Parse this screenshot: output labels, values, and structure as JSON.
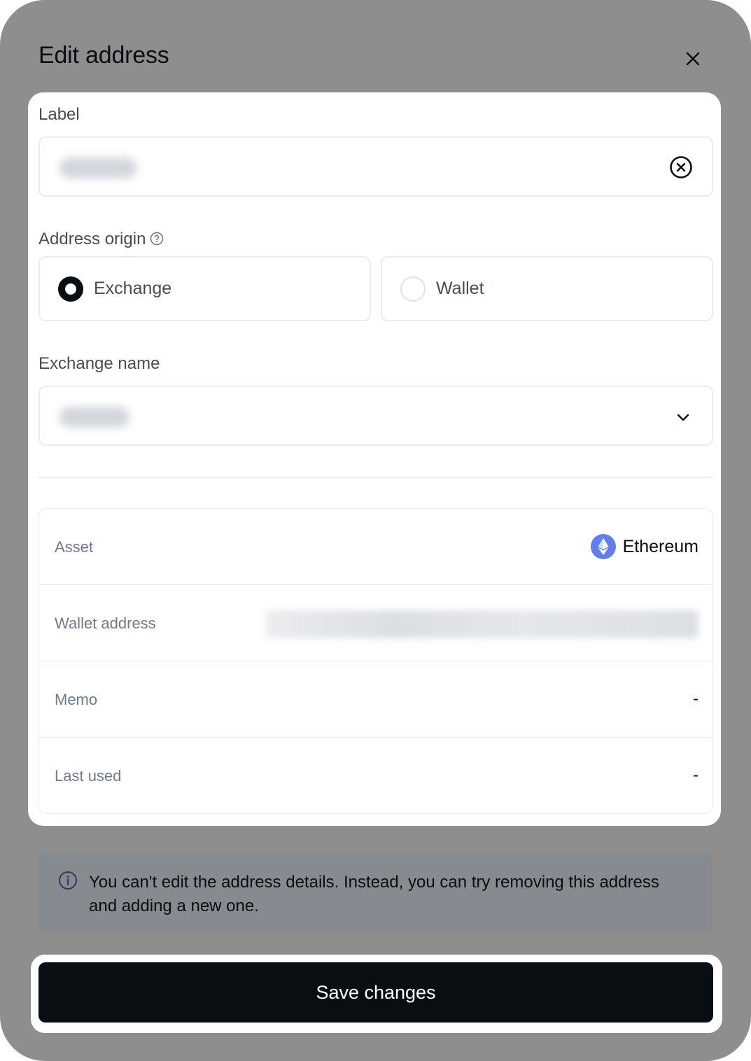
{
  "modal": {
    "title": "Edit address",
    "close_icon": "close-icon"
  },
  "label_field": {
    "label": "Label",
    "value_redacted": true,
    "clear_icon": "clear-circle-icon"
  },
  "address_origin": {
    "label": "Address origin",
    "help_icon": "question-circle-icon",
    "options": [
      {
        "label": "Exchange",
        "selected": true
      },
      {
        "label": "Wallet",
        "selected": false
      }
    ]
  },
  "exchange_name": {
    "label": "Exchange name",
    "value_redacted": true,
    "dropdown_icon": "chevron-down-icon"
  },
  "details": {
    "asset": {
      "key": "Asset",
      "value": "Ethereum",
      "icon": "ethereum-icon",
      "icon_color": "#627EEA"
    },
    "wallet_address": {
      "key": "Wallet address",
      "value_redacted": true
    },
    "memo": {
      "key": "Memo",
      "value": "-"
    },
    "last_used": {
      "key": "Last used",
      "value": "-"
    }
  },
  "notice": {
    "icon": "info-icon",
    "text": "You can't edit the address details. Instead, you can try removing this address and adding a new one."
  },
  "footer": {
    "save_label": "Save changes"
  },
  "colors": {
    "backdrop": "#8E8E8E",
    "primary_button": "#0B0E11",
    "border": "#EAECEF",
    "muted_text": "#707A8A"
  }
}
